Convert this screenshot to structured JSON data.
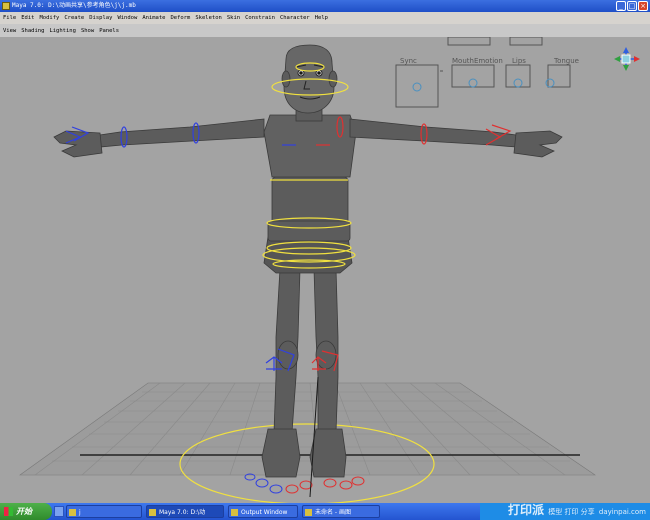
{
  "window": {
    "title": "Maya 7.0: D:\\动画共享\\参考角色\\j\\j.mb",
    "controls": [
      "_",
      "□",
      "×"
    ]
  },
  "menubar": {
    "items": [
      "File",
      "Edit",
      "Modify",
      "Create",
      "Display",
      "Window",
      "Animate",
      "Deform",
      "Skeleton",
      "Skin",
      "Constrain",
      "Character",
      "Help"
    ]
  },
  "panel_menu": {
    "items": [
      "View",
      "Shading",
      "Lighting",
      "Show",
      "Panels"
    ]
  },
  "face_controls": {
    "labels": [
      "Sync",
      "MouthEmotion",
      "Lips",
      "Tongue"
    ]
  },
  "taskbar": {
    "start_label": "开始",
    "tasks": [
      {
        "label": "j"
      },
      {
        "label": "Maya 7.0: D:\\动"
      },
      {
        "label": "Output Window"
      },
      {
        "label": "未命名 - 画图"
      }
    ],
    "watermark": "打印派",
    "watermark_sub": "模型 打印 分享",
    "watermark_url": "dayinpai.com"
  },
  "colors": {
    "viewport_bg": "#a3a3a3",
    "character": "#5a5a5a",
    "yellow_ctrl": "#f0e040",
    "red_ctrl": "#e03030",
    "blue_ctrl": "#3040e0"
  }
}
